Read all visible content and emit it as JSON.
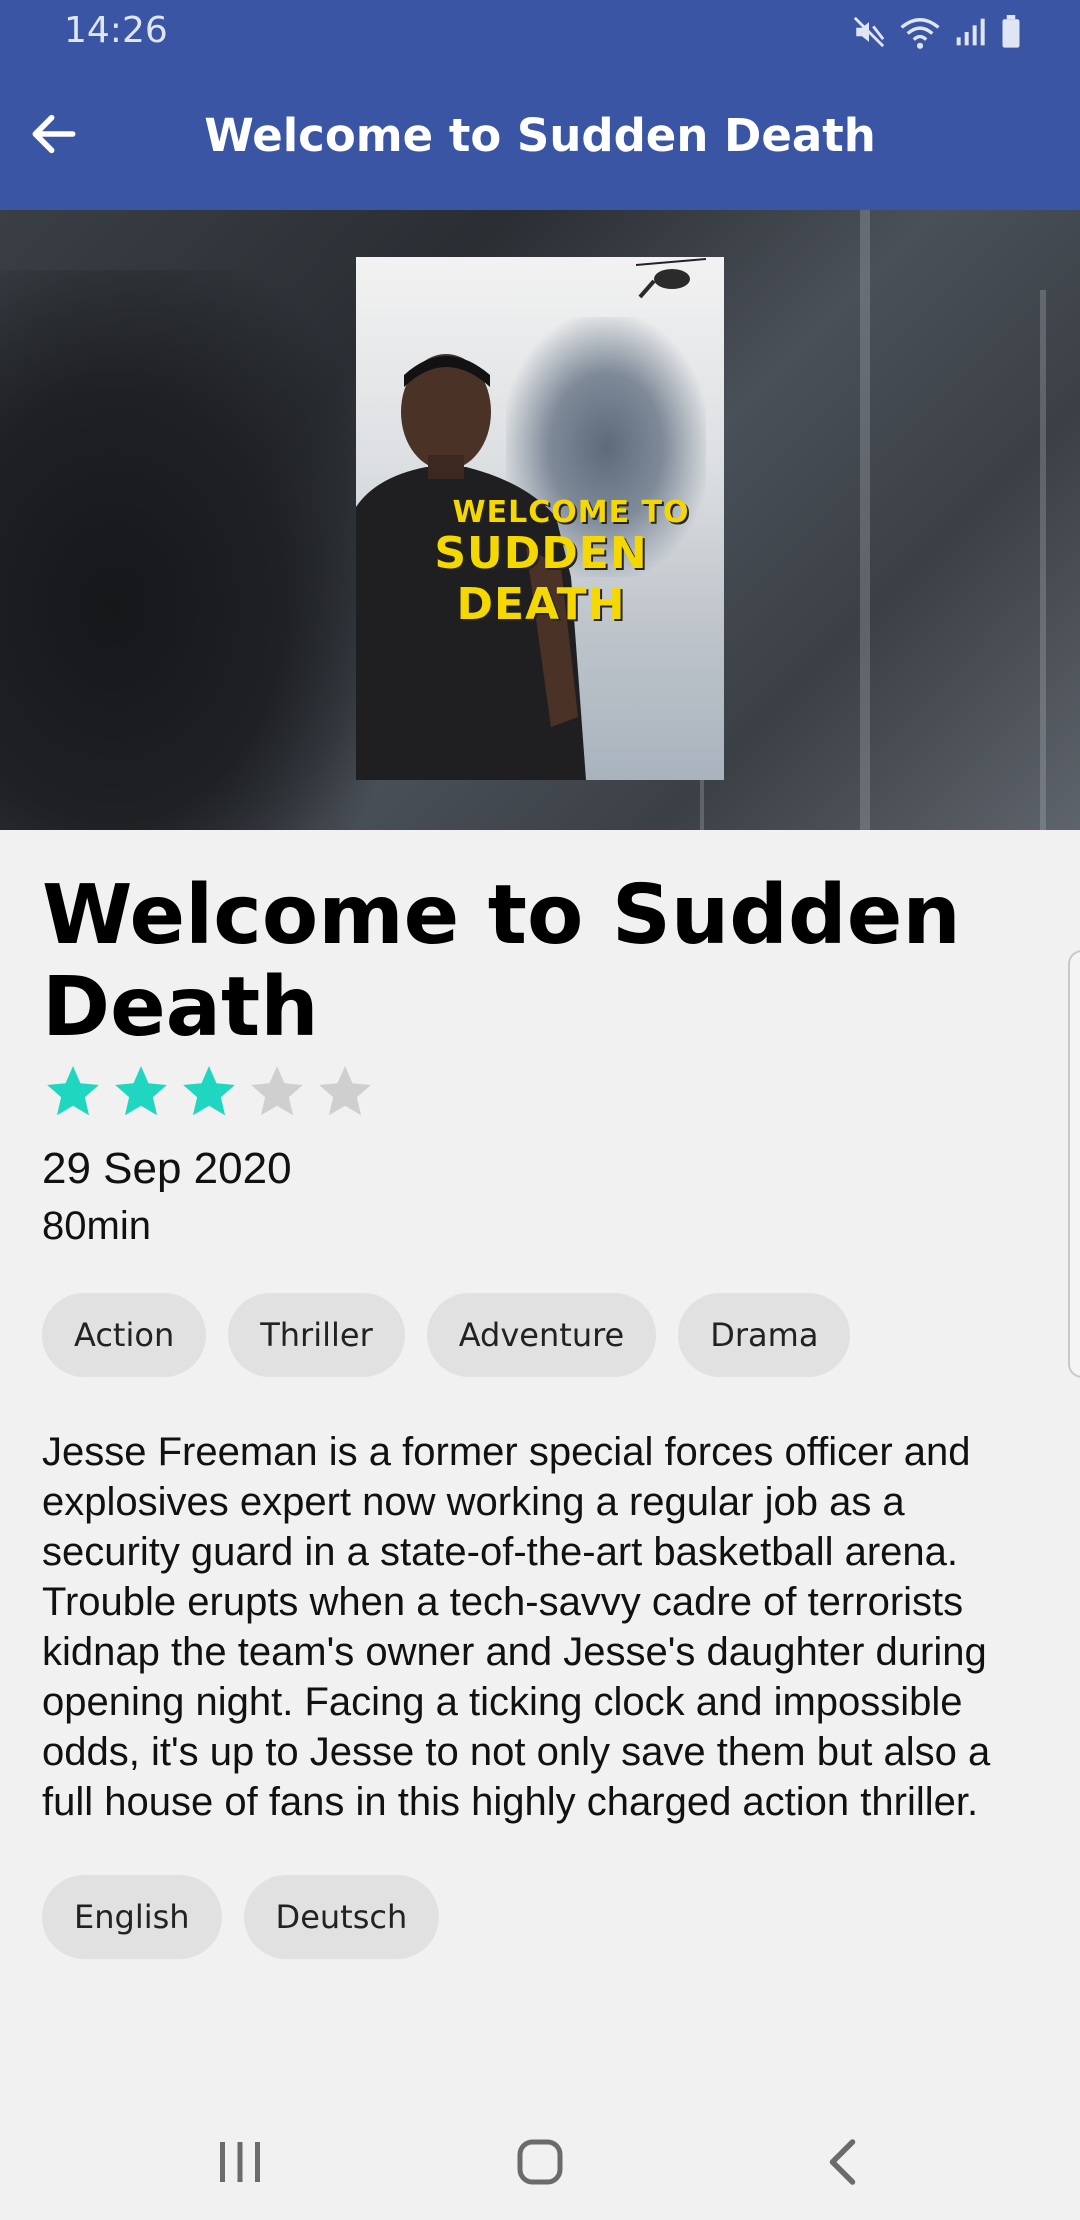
{
  "status_bar": {
    "time": "14:26",
    "icons": [
      "mute-icon",
      "wifi-icon",
      "signal-icon",
      "battery-icon"
    ]
  },
  "app_bar": {
    "title": "Welcome to Sudden Death",
    "back_icon": "arrow-left-icon"
  },
  "poster": {
    "title_line1": "WELCOME TO",
    "title_line2": "SUDDEN DEATH"
  },
  "movie": {
    "title": "Welcome to Sudden Death",
    "rating": {
      "value": 3,
      "max": 5,
      "filled_color": "#1fd6c0",
      "empty_color": "#cfcfcf"
    },
    "release_date": "29 Sep 2020",
    "runtime": "80min",
    "genres": [
      "Action",
      "Thriller",
      "Adventure",
      "Drama"
    ],
    "overview": "Jesse Freeman is a former special forces officer and explosives expert now working a regular job as a security guard in a state-of-the-art basketball arena. Trouble erupts when a tech-savvy cadre of terrorists kidnap the team's owner and Jesse's daughter during opening night. Facing a ticking clock and impossible odds, it's up to Jesse to not only save them but also a full house of fans in this highly charged action thriller.",
    "languages": [
      "English",
      "Deutsch"
    ]
  },
  "nav_bar": {
    "buttons": [
      "recents-icon",
      "home-icon",
      "back-icon"
    ]
  },
  "colors": {
    "primary": "#3a55a4",
    "background": "#f1f1f1",
    "chip": "#e1e1e1"
  }
}
